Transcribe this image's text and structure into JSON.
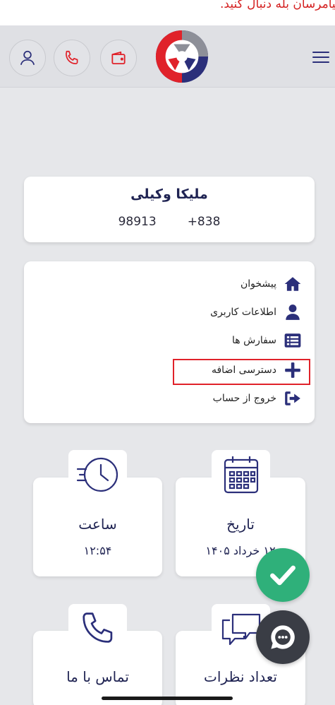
{
  "banner": {
    "text": "...پیامرسان بله دنبال کنید."
  },
  "header": {
    "user_icon": "user-icon",
    "phone_icon": "phone-icon",
    "wallet_icon": "wallet-icon",
    "menu_icon": "hamburger-menu-icon"
  },
  "profile": {
    "name": "ملیکا وکیلی",
    "phone_prefix": "+838",
    "phone_number": "98913"
  },
  "menu": {
    "items": [
      {
        "label": "پیشخوان",
        "icon": "home-icon"
      },
      {
        "label": "اطلاعات کاربری",
        "icon": "user-icon"
      },
      {
        "label": "سفارش ها",
        "icon": "list-icon"
      },
      {
        "label": "دسترسی اضافه",
        "icon": "plus-icon"
      },
      {
        "label": "خروج از حساب",
        "icon": "logout-icon"
      }
    ]
  },
  "tiles": {
    "date": {
      "title": "تاریخ",
      "value": "۱۲ خرداد ۱۴۰۵",
      "icon": "calendar-icon"
    },
    "time": {
      "title": "ساعت",
      "value": "۱۲:۵۴",
      "icon": "clock-icon"
    },
    "comments": {
      "title": "تعداد نظرات",
      "icon": "chat-bubbles-icon"
    },
    "contact": {
      "title": "تماس با ما",
      "icon": "phone-icon"
    }
  },
  "colors": {
    "brand_navy": "#2b2f7a",
    "brand_red": "#e0222a",
    "success_green": "#2fb07a",
    "chat_dark": "#3a3d45"
  }
}
